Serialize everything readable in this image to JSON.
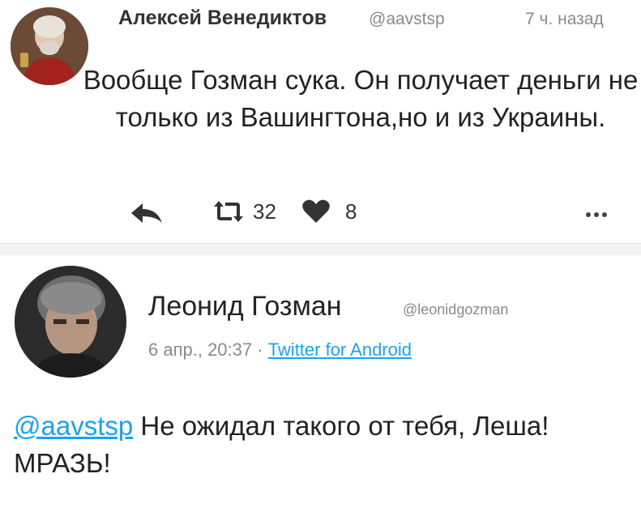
{
  "tweet1": {
    "author_name": "Алексей Венедиктов",
    "handle": "@aavstsp",
    "time": "7 ч. назад",
    "text": "Вообще Гозман сука. Он получает деньги не только из Вашингтона,но и из Украины.",
    "actions": {
      "reply_icon": "reply-icon",
      "retweet_icon": "retweet-icon",
      "retweet_count": "32",
      "like_icon": "heart-icon",
      "like_count": "8",
      "more_icon": "more-dots-icon"
    }
  },
  "tweet2": {
    "author_name": "Леонид Гозман",
    "handle": "@leonidgozman",
    "date": "6 апр., 20:37",
    "separator": " · ",
    "source": "Twitter for Android",
    "mention": "@aavstsp",
    "text": " Не ожидал такого от тебя, Леша! МРАЗЬ!"
  },
  "colors": {
    "link": "#1da1f2",
    "muted": "#8a8a8a",
    "text": "#222222"
  }
}
